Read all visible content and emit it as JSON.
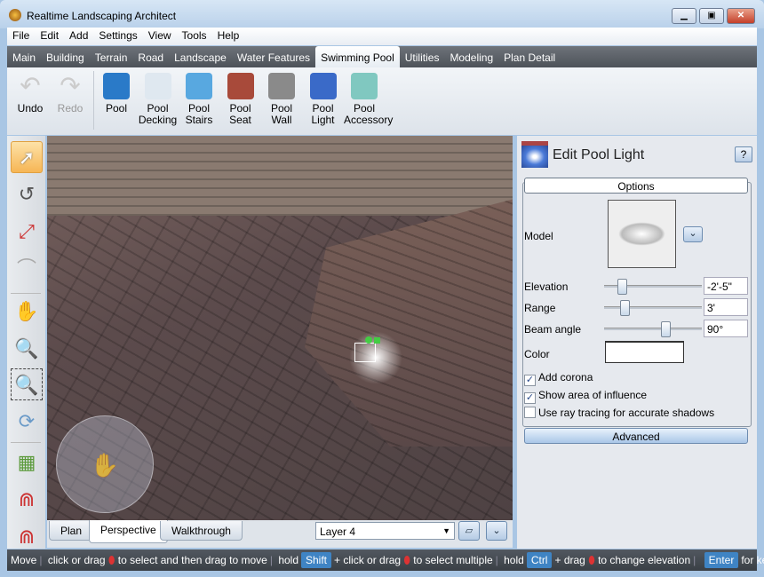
{
  "window": {
    "title": "Realtime Landscaping Architect",
    "app_icon": "flame-icon"
  },
  "menu": [
    "File",
    "Edit",
    "Add",
    "Settings",
    "View",
    "Tools",
    "Help"
  ],
  "tabs": [
    "Main",
    "Building",
    "Terrain",
    "Road",
    "Landscape",
    "Water Features",
    "Swimming Pool",
    "Utilities",
    "Modeling",
    "Plan Detail"
  ],
  "active_tab": "Swimming Pool",
  "ribbon": {
    "undo": "Undo",
    "redo": "Redo",
    "items": [
      {
        "l1": "Pool",
        "l2": "",
        "color": "#2a7ac8"
      },
      {
        "l1": "Pool",
        "l2": "Decking",
        "color": "#dfe8f0"
      },
      {
        "l1": "Pool",
        "l2": "Stairs",
        "color": "#58a8e0"
      },
      {
        "l1": "Pool",
        "l2": "Seat",
        "color": "#a84a3a"
      },
      {
        "l1": "Pool",
        "l2": "Wall",
        "color": "#8a8a8a"
      },
      {
        "l1": "Pool",
        "l2": "Light",
        "color": "#3a6ac8"
      },
      {
        "l1": "Pool",
        "l2": "Accessory",
        "color": "#80c8c0"
      }
    ]
  },
  "view_tabs": [
    "Plan",
    "Perspective",
    "Walkthrough"
  ],
  "active_view_tab": "Perspective",
  "layer_select": "Layer 4",
  "panel": {
    "title": "Edit Pool Light",
    "help": "?",
    "options_label": "Options",
    "model_label": "Model",
    "elevation": {
      "label": "Elevation",
      "value": "-2'-5\"",
      "slider_fraction": 0.15
    },
    "range": {
      "label": "Range",
      "value": "3'",
      "slider_fraction": 0.18
    },
    "beam_angle": {
      "label": "Beam angle",
      "value": "90°",
      "slider_fraction": 0.65
    },
    "color": {
      "label": "Color",
      "value": "#ffffff"
    },
    "checkboxes": [
      {
        "label": "Add corona",
        "checked": true
      },
      {
        "label": "Show area of influence",
        "checked": true
      },
      {
        "label": "Use ray tracing for accurate shadows",
        "checked": false
      }
    ],
    "advanced": "Advanced"
  },
  "status": {
    "mode": "Move",
    "s1": "click or drag",
    "s2": "to select and then drag to move",
    "s3": "hold",
    "k1": "Shift",
    "s4": "+ click or drag",
    "s5": "to select multiple",
    "s6": "hold",
    "k2": "Ctrl",
    "s7": "+ drag",
    "s8": "to change elevation",
    "k3": "Enter",
    "s9": "for keyboard"
  }
}
